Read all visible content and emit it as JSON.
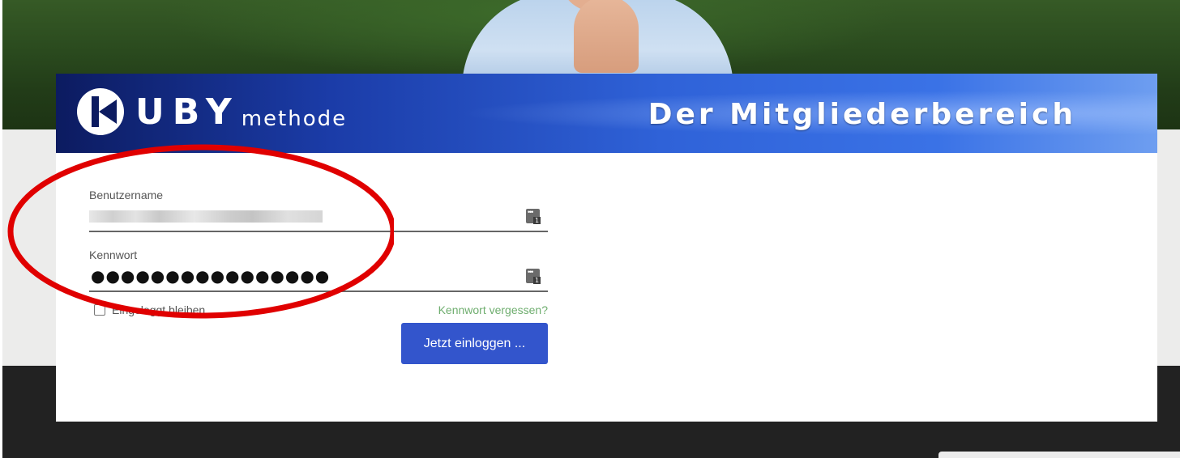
{
  "banner": {
    "logo_text": "UBY",
    "logo_sub": "methode",
    "title": "Der Mitgliederbereich"
  },
  "form": {
    "username_label": "Benutzername",
    "password_label": "Kennwort",
    "password_value": "●●●●●●●●●●●●●●●●",
    "remember_label": "Eingeloggt bleiben",
    "forgot_link": "Kennwort vergessen?",
    "login_button": "Jetzt einloggen ..."
  },
  "icons": {
    "logo": "kuby-logo-icon",
    "password_manager": "password-manager-icon",
    "checkbox": "checkbox-icon"
  },
  "colors": {
    "button_bg": "#3355cc",
    "link": "#6fae6f",
    "annotation": "#e00000"
  }
}
